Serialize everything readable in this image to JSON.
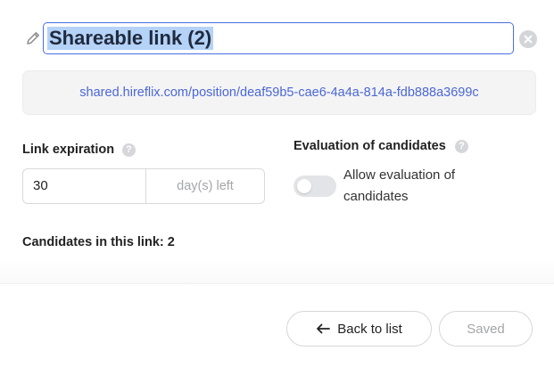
{
  "header": {
    "title": "Shareable link (2)"
  },
  "share": {
    "url": "shared.hireflix.com/position/deaf59b5-cae6-4a4a-814a-fdb888a3699c"
  },
  "expiration": {
    "label": "Link expiration",
    "value": "30",
    "suffix": "day(s) left"
  },
  "evaluation": {
    "label": "Evaluation of candidates",
    "toggle_label": "Allow evaluation of candidates",
    "enabled": false
  },
  "candidates": {
    "label": "Candidates in this link: 2"
  },
  "footer": {
    "back_label": "Back to list",
    "saved_label": "Saved"
  },
  "colors": {
    "accent": "#4a67d6",
    "selection": "#b5d2f7",
    "muted": "#a4a6aa"
  }
}
